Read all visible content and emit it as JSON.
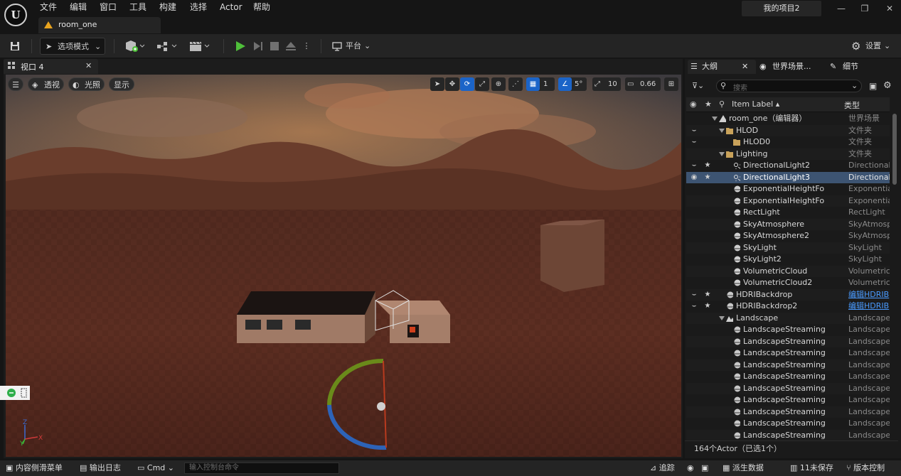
{
  "menu": [
    "文件",
    "编辑",
    "窗口",
    "工具",
    "构建",
    "选择",
    "Actor",
    "帮助"
  ],
  "project_name": "我的项目2",
  "document_tab": "room_one",
  "toolbar": {
    "mode_label": "选项模式",
    "platform_label": "平台",
    "settings_label": "设置"
  },
  "viewport": {
    "tab_label": "视口 4",
    "perspective_label": "透视",
    "lighting_label": "光照",
    "show_label": "显示",
    "grid_snap": "1",
    "rotation_snap": "5°",
    "scale_snap": "10",
    "camera_speed": "0.66"
  },
  "outliner": {
    "tabs": {
      "outliner": "大纲",
      "world": "世界场景...",
      "details": "细节"
    },
    "search_placeholder": "搜索",
    "col_label": "Item Label",
    "col_type": "类型",
    "rows": [
      {
        "name": "room_one（编辑器）",
        "type": "世界场景",
        "indent": 3,
        "icon": "level",
        "expand": true,
        "eye": false,
        "star": false,
        "link": false,
        "sel": false
      },
      {
        "name": "HLOD",
        "type": "文件夹",
        "indent": 4,
        "icon": "folder",
        "expand": true,
        "eye": true,
        "star": false,
        "link": false,
        "sel": false
      },
      {
        "name": "HLOD0",
        "type": "文件夹",
        "indent": 5,
        "icon": "folder",
        "expand": false,
        "eye": true,
        "star": false,
        "link": false,
        "sel": false
      },
      {
        "name": "Lighting",
        "type": "文件夹",
        "indent": 4,
        "icon": "folder",
        "expand": true,
        "eye": false,
        "star": false,
        "link": false,
        "sel": false
      },
      {
        "name": "DirectionalLight2",
        "type": "DirectionalL",
        "indent": 5,
        "icon": "dirlight",
        "expand": false,
        "eye": true,
        "star": true,
        "link": false,
        "sel": false
      },
      {
        "name": "DirectionalLight3",
        "type": "DirectionalL",
        "indent": 5,
        "icon": "dirlight",
        "expand": false,
        "eye": true,
        "star": true,
        "link": false,
        "sel": true
      },
      {
        "name": "ExponentialHeightFo",
        "type": "Exponential",
        "indent": 5,
        "icon": "fog",
        "expand": false,
        "eye": false,
        "star": false,
        "link": false,
        "sel": false
      },
      {
        "name": "ExponentialHeightFo",
        "type": "Exponential",
        "indent": 5,
        "icon": "fog",
        "expand": false,
        "eye": false,
        "star": false,
        "link": false,
        "sel": false
      },
      {
        "name": "RectLight",
        "type": "RectLight",
        "indent": 5,
        "icon": "rect",
        "expand": false,
        "eye": false,
        "star": false,
        "link": false,
        "sel": false
      },
      {
        "name": "SkyAtmosphere",
        "type": "SkyAtmosp",
        "indent": 5,
        "icon": "sky",
        "expand": false,
        "eye": false,
        "star": false,
        "link": false,
        "sel": false
      },
      {
        "name": "SkyAtmosphere2",
        "type": "SkyAtmosp",
        "indent": 5,
        "icon": "sky",
        "expand": false,
        "eye": false,
        "star": false,
        "link": false,
        "sel": false
      },
      {
        "name": "SkyLight",
        "type": "SkyLight",
        "indent": 5,
        "icon": "skylight",
        "expand": false,
        "eye": false,
        "star": false,
        "link": false,
        "sel": false
      },
      {
        "name": "SkyLight2",
        "type": "SkyLight",
        "indent": 5,
        "icon": "skylight",
        "expand": false,
        "eye": false,
        "star": false,
        "link": false,
        "sel": false
      },
      {
        "name": "VolumetricCloud",
        "type": "VolumetricC",
        "indent": 5,
        "icon": "cloud",
        "expand": false,
        "eye": false,
        "star": false,
        "link": false,
        "sel": false
      },
      {
        "name": "VolumetricCloud2",
        "type": "VolumetricC",
        "indent": 5,
        "icon": "cloud",
        "expand": false,
        "eye": false,
        "star": false,
        "link": false,
        "sel": false
      },
      {
        "name": "HDRIBackdrop",
        "type": "编辑HDRIB",
        "indent": 4,
        "icon": "sphere",
        "expand": false,
        "eye": true,
        "star": true,
        "link": true,
        "sel": false
      },
      {
        "name": "HDRIBackdrop2",
        "type": "编辑HDRIB",
        "indent": 4,
        "icon": "sphere",
        "expand": false,
        "eye": true,
        "star": true,
        "link": true,
        "sel": false
      },
      {
        "name": "Landscape",
        "type": "Landscape",
        "indent": 4,
        "icon": "mountain",
        "expand": true,
        "eye": false,
        "star": false,
        "link": false,
        "sel": false
      },
      {
        "name": "LandscapeStreaming",
        "type": "LandscapeS",
        "indent": 5,
        "icon": "sphere",
        "expand": false,
        "eye": false,
        "star": false,
        "link": false,
        "sel": false
      },
      {
        "name": "LandscapeStreaming",
        "type": "LandscapeS",
        "indent": 5,
        "icon": "sphere",
        "expand": false,
        "eye": false,
        "star": false,
        "link": false,
        "sel": false
      },
      {
        "name": "LandscapeStreaming",
        "type": "LandscapeS",
        "indent": 5,
        "icon": "sphere",
        "expand": false,
        "eye": false,
        "star": false,
        "link": false,
        "sel": false
      },
      {
        "name": "LandscapeStreaming",
        "type": "LandscapeS",
        "indent": 5,
        "icon": "sphere",
        "expand": false,
        "eye": false,
        "star": false,
        "link": false,
        "sel": false
      },
      {
        "name": "LandscapeStreaming",
        "type": "LandscapeS",
        "indent": 5,
        "icon": "sphere",
        "expand": false,
        "eye": false,
        "star": false,
        "link": false,
        "sel": false
      },
      {
        "name": "LandscapeStreaming",
        "type": "LandscapeS",
        "indent": 5,
        "icon": "sphere",
        "expand": false,
        "eye": false,
        "star": false,
        "link": false,
        "sel": false
      },
      {
        "name": "LandscapeStreaming",
        "type": "LandscapeS",
        "indent": 5,
        "icon": "sphere",
        "expand": false,
        "eye": false,
        "star": false,
        "link": false,
        "sel": false
      },
      {
        "name": "LandscapeStreaming",
        "type": "LandscapeS",
        "indent": 5,
        "icon": "sphere",
        "expand": false,
        "eye": false,
        "star": false,
        "link": false,
        "sel": false
      },
      {
        "name": "LandscapeStreaming",
        "type": "LandscapeS",
        "indent": 5,
        "icon": "sphere",
        "expand": false,
        "eye": false,
        "star": false,
        "link": false,
        "sel": false
      },
      {
        "name": "LandscapeStreaming",
        "type": "LandscapeS",
        "indent": 5,
        "icon": "sphere",
        "expand": false,
        "eye": false,
        "star": false,
        "link": false,
        "sel": false
      }
    ],
    "footer": "164个Actor（已选1个）"
  },
  "statusbar": {
    "content_drawer": "内容侧滑菜单",
    "output_log": "输出日志",
    "cmd": "Cmd",
    "cmd_placeholder": "输入控制台命令",
    "trace": "追踪",
    "derived_data": "派生数据",
    "unsaved": "11未保存",
    "source_control": "版本控制"
  },
  "colors": {
    "accent": "#1b64c8",
    "selected_row": "#3d5472",
    "link": "#4a9bff",
    "play": "#4fbf3a"
  }
}
